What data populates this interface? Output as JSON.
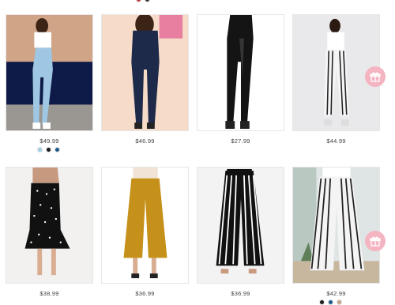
{
  "products": [
    {
      "price": "$49.99",
      "bg": "#3c3b48",
      "swatches": [
        "#9fd0ea",
        "#1a1a1a",
        "#1f5b8a"
      ]
    },
    {
      "price": "$46.99",
      "bg": "#f6dcc8",
      "swatches": []
    },
    {
      "price": "$27.99",
      "bg": "#ffffff",
      "swatches": []
    },
    {
      "price": "$44.99",
      "bg": "#e9e8ea",
      "swatches": []
    },
    {
      "price": "$38.99",
      "bg": "#f2f1ef",
      "swatches": []
    },
    {
      "price": "$36.99",
      "bg": "#ffffff",
      "swatches": []
    },
    {
      "price": "$36.99",
      "bg": "#f3f3f3",
      "swatches": []
    },
    {
      "price": "$42.99",
      "bg": "#dfe5e4",
      "swatches": [
        "#1a1a1a",
        "#1f5b8a",
        "#c9a38a"
      ]
    }
  ],
  "top_swatches": [
    "#c23b3b",
    "#333333"
  ],
  "icons": {
    "gift": "gift-icon"
  },
  "colors": {
    "gift_bg": "#f4b4c1"
  }
}
